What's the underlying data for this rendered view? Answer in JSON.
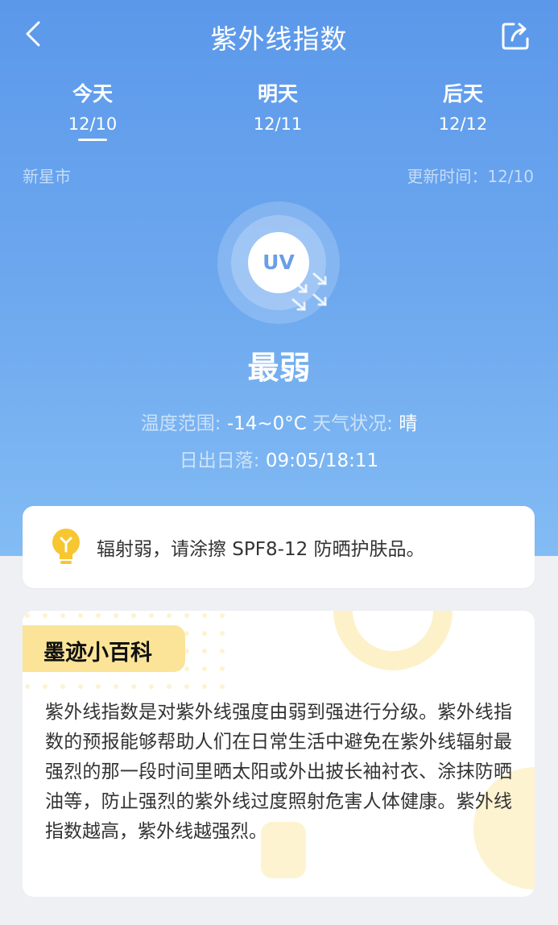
{
  "header": {
    "title": "紫外线指数"
  },
  "tabs": [
    {
      "day": "今天",
      "date": "12/10"
    },
    {
      "day": "明天",
      "date": "12/11"
    },
    {
      "day": "后天",
      "date": "12/12"
    }
  ],
  "city": "新星市",
  "update_time": "更新时间：12/10",
  "uv": {
    "badge": "UV",
    "level": "最弱"
  },
  "weather": {
    "temp_label": "温度范围: ",
    "temp_value": "-14~0°C",
    "cond_label": " 天气状况: ",
    "cond_value": "晴",
    "sun_label": "日出日落: ",
    "sun_value": "09:05/18:11"
  },
  "tip": {
    "text": "辐射弱，请涂擦 SPF8-12 防晒护肤品。",
    "icon": "lightbulb-icon"
  },
  "wiki": {
    "title": "墨迹小百科",
    "body": "紫外线指数是对紫外线强度由弱到强进行分级。紫外线指数的预报能够帮助人们在日常生活中避免在紫外线辐射最强烈的那一段时间里晒太阳或外出披长袖衬衣、涂抹防晒油等，防止强烈的紫外线过度照射危害人体健康。紫外线指数越高，紫外线越强烈。"
  },
  "colors": {
    "hero_top": "#5b98ea",
    "hero_bottom": "#83bcf4",
    "bulb": "#f7c630",
    "wiki_tag": "#fbe498"
  }
}
